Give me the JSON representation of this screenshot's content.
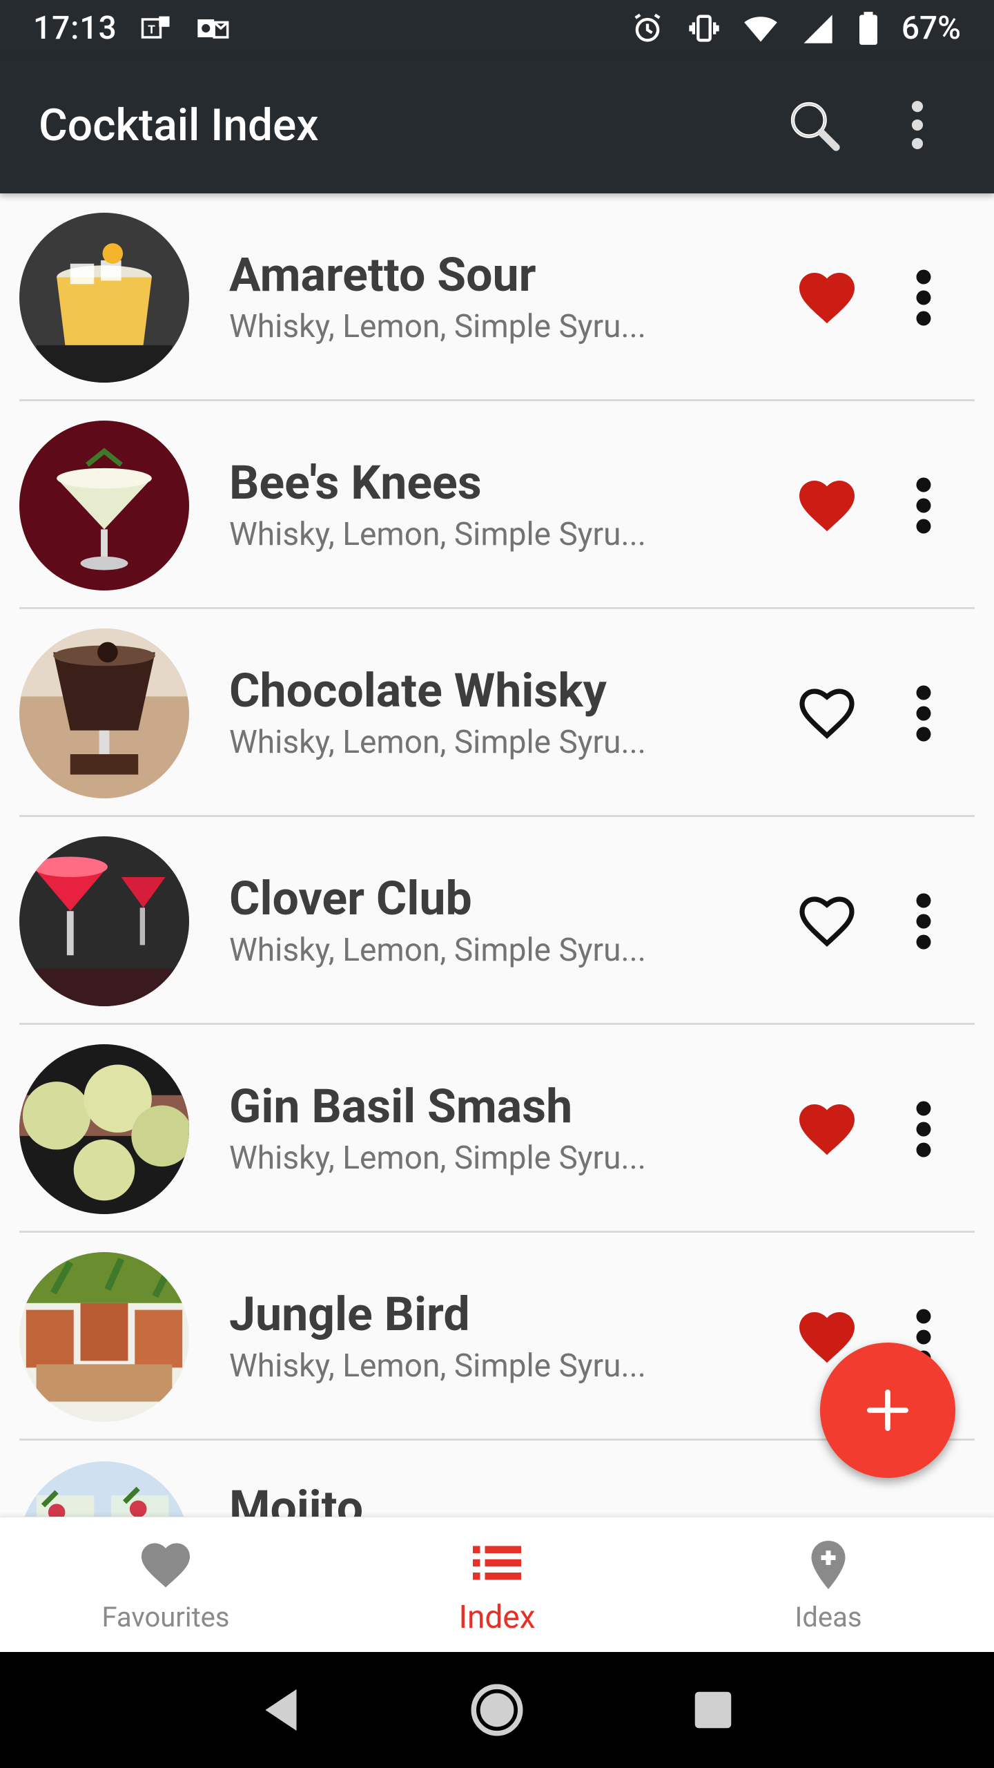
{
  "status_bar": {
    "time": "17:13",
    "battery_percent": "67%",
    "left_icons": [
      "teams-icon",
      "outlook-icon"
    ],
    "right_icons": [
      "alarm-icon",
      "vibrate-icon",
      "wifi-icon",
      "signal-icon",
      "battery-icon"
    ]
  },
  "app_bar": {
    "title": "Cocktail Index",
    "actions": [
      "search-icon",
      "more-vert-icon"
    ]
  },
  "cocktails": [
    {
      "name": "Amaretto Sour",
      "ingredients": "Whisky, Lemon, Simple Syru...",
      "favourite": true
    },
    {
      "name": "Bee's Knees",
      "ingredients": "Whisky, Lemon, Simple Syru...",
      "favourite": true
    },
    {
      "name": "Chocolate Whisky",
      "ingredients": "Whisky, Lemon, Simple Syru...",
      "favourite": false
    },
    {
      "name": "Clover Club",
      "ingredients": "Whisky, Lemon, Simple Syru...",
      "favourite": false
    },
    {
      "name": "Gin Basil Smash",
      "ingredients": "Whisky, Lemon, Simple Syru...",
      "favourite": true
    },
    {
      "name": "Jungle Bird",
      "ingredients": "Whisky, Lemon, Simple Syru...",
      "favourite": true
    },
    {
      "name": "Mojito",
      "ingredients": "",
      "favourite": false
    }
  ],
  "fab": {
    "icon": "add-icon"
  },
  "bottom_nav": {
    "items": [
      {
        "label": "Favourites",
        "icon": "heart-icon",
        "active": false
      },
      {
        "label": "Index",
        "icon": "list-icon",
        "active": true
      },
      {
        "label": "Ideas",
        "icon": "add-location-icon",
        "active": false
      }
    ]
  },
  "system_nav": {
    "buttons": [
      "back-icon",
      "home-icon",
      "recents-icon"
    ]
  },
  "colors": {
    "app_bar": "#262b2f",
    "accent": "#e53127",
    "heart_filled": "#cc1d14",
    "background": "#fafafa"
  }
}
